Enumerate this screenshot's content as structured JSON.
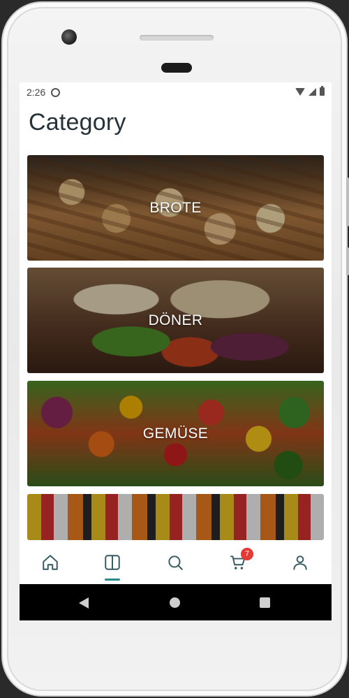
{
  "status_bar": {
    "time": "2:26",
    "icons": [
      "sync-icon",
      "wifi-icon",
      "signal-icon",
      "battery-icon"
    ]
  },
  "page": {
    "title": "Category"
  },
  "categories": [
    {
      "label": "BROTE"
    },
    {
      "label": "DÖNER"
    },
    {
      "label": "GEMÜSE"
    },
    {
      "label": ""
    }
  ],
  "bottom_nav": {
    "items": [
      {
        "icon": "home-icon",
        "active": false
      },
      {
        "icon": "category-icon",
        "active": true
      },
      {
        "icon": "search-icon",
        "active": false
      },
      {
        "icon": "cart-icon",
        "active": false,
        "badge": "7"
      },
      {
        "icon": "profile-icon",
        "active": false
      }
    ]
  },
  "colors": {
    "title_text": "#263238",
    "accent": "#2a8a8a",
    "nav_icon": "#34595f",
    "badge": "#e53935"
  },
  "system_nav": {
    "icons": [
      "back-icon",
      "home-circle-icon",
      "recent-apps-icon"
    ]
  }
}
